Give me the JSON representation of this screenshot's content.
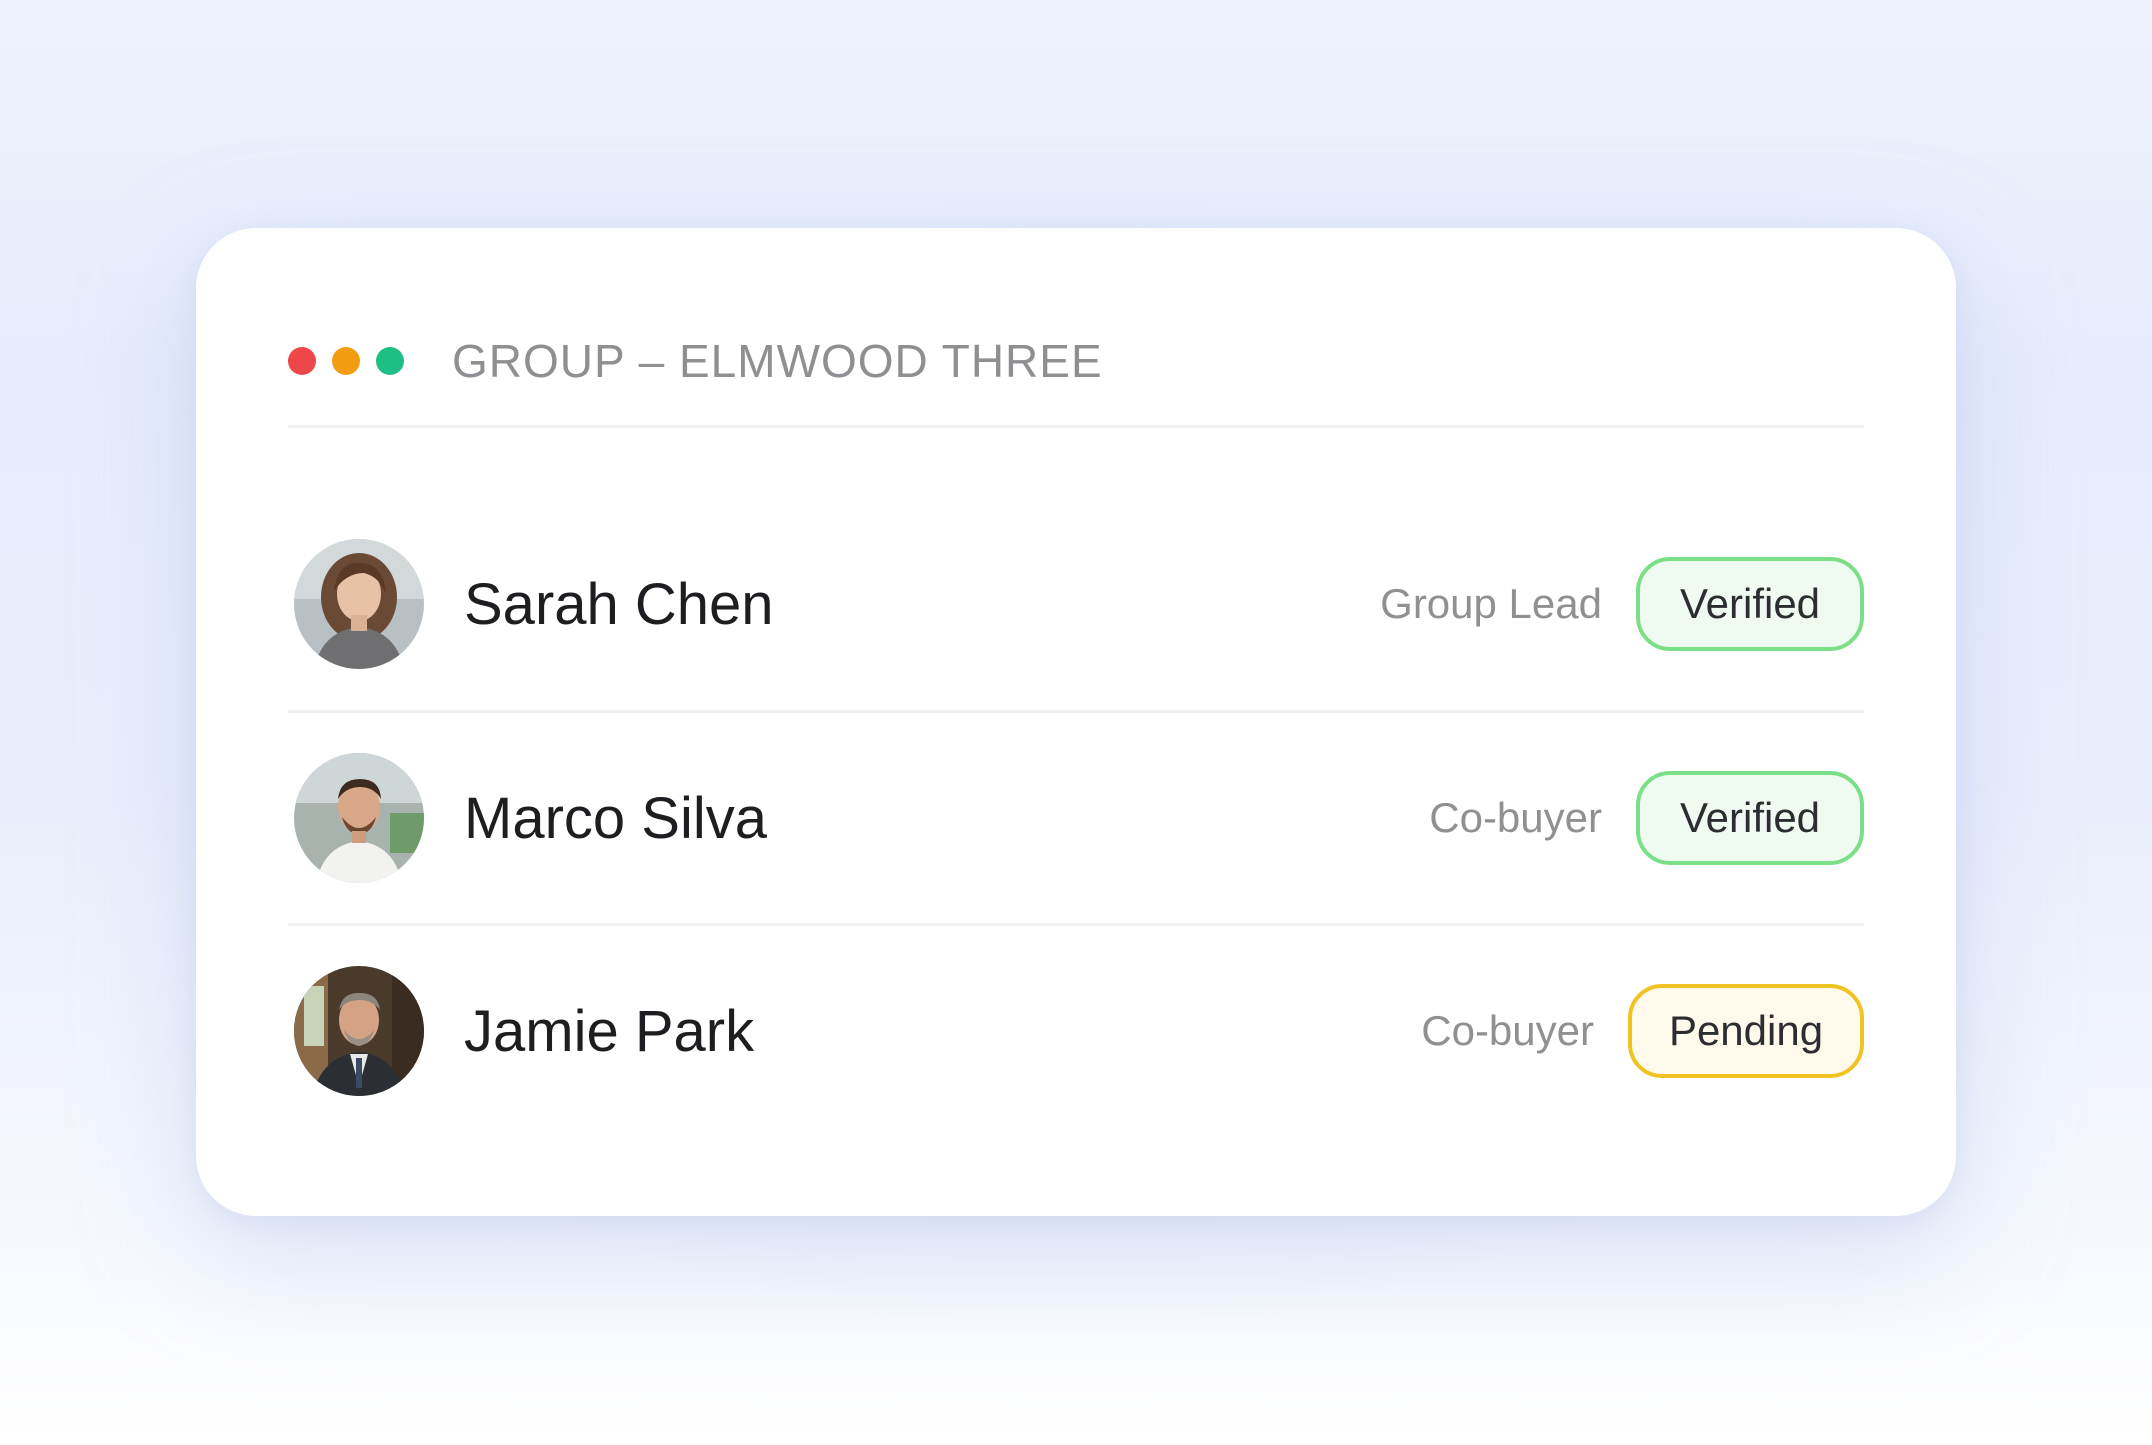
{
  "window": {
    "title": "GROUP – ELMWOOD THREE",
    "controls": [
      {
        "name": "close",
        "color": "#ee4749"
      },
      {
        "name": "minimize",
        "color": "#f29d10"
      },
      {
        "name": "maximize",
        "color": "#1ebf84"
      }
    ]
  },
  "members": [
    {
      "name": "Sarah Chen",
      "role": "Group Lead",
      "status": "Verified",
      "status_color": "#7adf86"
    },
    {
      "name": "Marco Silva",
      "role": "Co-buyer",
      "status": "Verified",
      "status_color": "#7adf86"
    },
    {
      "name": "Jamie Park",
      "role": "Co-buyer",
      "status": "Pending",
      "status_color": "#f0c323"
    }
  ]
}
